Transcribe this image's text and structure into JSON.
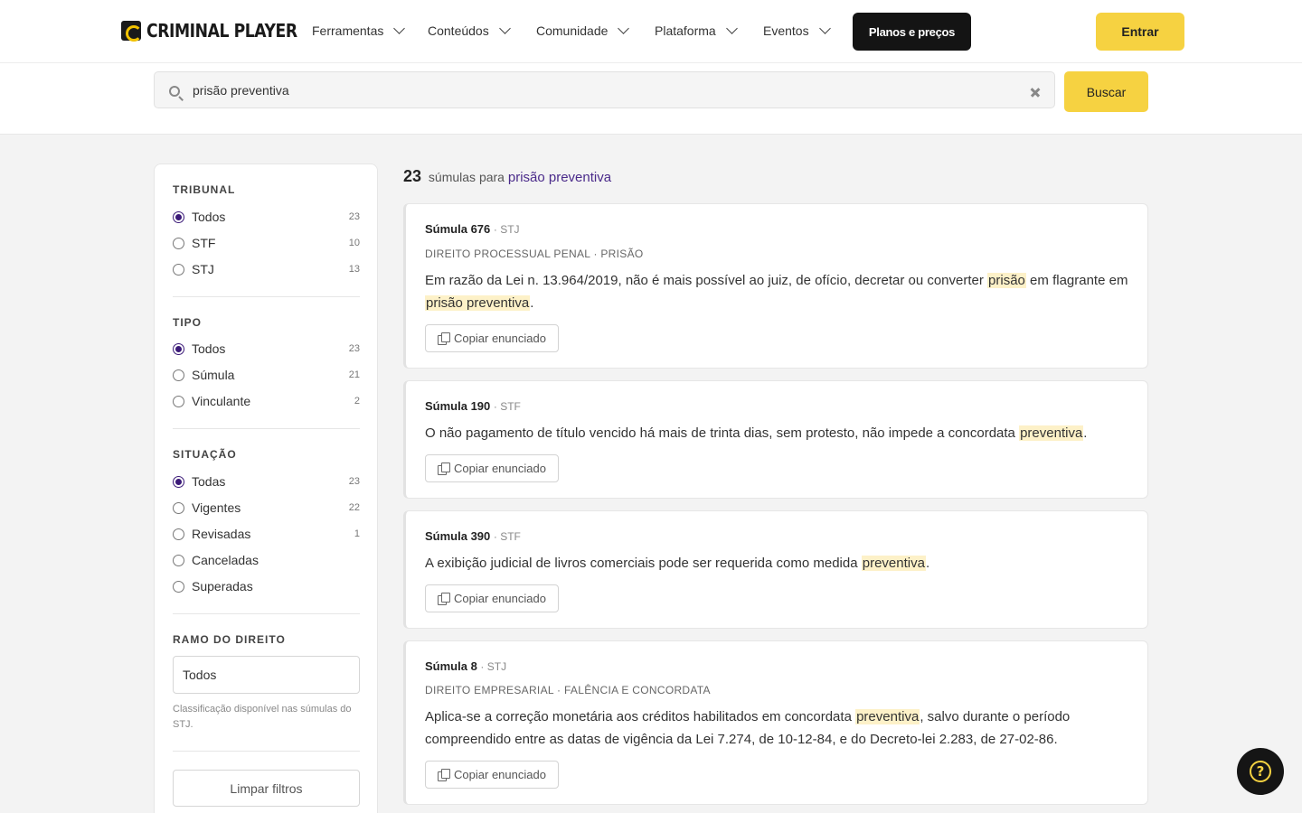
{
  "header": {
    "logo_text": "CRIMINAL PLAYER",
    "nav": [
      "Ferramentas",
      "Conteúdos",
      "Comunidade",
      "Plataforma",
      "Eventos"
    ],
    "planos_label": "Planos e preços",
    "entrar_label": "Entrar"
  },
  "search": {
    "value": "prisão preventiva",
    "button_label": "Buscar"
  },
  "filters": {
    "tribunal": {
      "title": "TRIBUNAL",
      "options": [
        {
          "label": "Todos",
          "count": "23"
        },
        {
          "label": "STF",
          "count": "10"
        },
        {
          "label": "STJ",
          "count": "13"
        }
      ]
    },
    "tipo": {
      "title": "TIPO",
      "options": [
        {
          "label": "Todos",
          "count": "23"
        },
        {
          "label": "Súmula",
          "count": "21"
        },
        {
          "label": "Vinculante",
          "count": "2"
        }
      ]
    },
    "situacao": {
      "title": "SITUAÇÃO",
      "options": [
        {
          "label": "Todas",
          "count": "23"
        },
        {
          "label": "Vigentes",
          "count": "22"
        },
        {
          "label": "Revisadas",
          "count": "1"
        },
        {
          "label": "Canceladas",
          "count": ""
        },
        {
          "label": "Superadas",
          "count": ""
        }
      ]
    },
    "ramo": {
      "title": "RAMO DO DIREITO",
      "selected": "Todos",
      "hint": "Classificação disponível nas súmulas do STJ."
    },
    "clear_label": "Limpar filtros"
  },
  "results": {
    "count": "23",
    "label": "súmulas para",
    "query": "prisão preventiva",
    "copy_label": "Copiar enunciado",
    "items": [
      {
        "title": "Súmula 676",
        "tribunal": "· STJ",
        "category": "DIREITO PROCESSUAL PENAL · PRISÃO",
        "t1": "Em razão da Lei n. 13.964/2019, não é mais possível ao juiz, de ofício, decretar ou converter ",
        "h1": "prisão",
        "t2": " em flagrante em ",
        "h2": "prisão preventiva",
        "t3": "."
      },
      {
        "title": "Súmula 190",
        "tribunal": "· STF",
        "t1": "O não pagamento de título vencido há mais de trinta dias, sem protesto, não impede a concordata ",
        "h1": "preventiva",
        "t2": "."
      },
      {
        "title": "Súmula 390",
        "tribunal": "· STF",
        "t1": "A exibição judicial de livros comerciais pode ser requerida como medida ",
        "h1": "preventiva",
        "t2": "."
      },
      {
        "title": "Súmula 8",
        "tribunal": "· STJ",
        "category": "DIREITO EMPRESARIAL · FALÊNCIA E CONCORDATA",
        "t1": "Aplica-se a correção monetária aos créditos habilitados em concordata ",
        "h1": "preventiva",
        "t2": ", salvo durante o período compreendido entre as datas de vigência da Lei 7.274, de 10-12-84, e do Decreto-lei 2.283, de 27-02-86."
      }
    ]
  },
  "help": {
    "icon": "question-icon",
    "glyph": "?"
  },
  "colors": {
    "accent_yellow": "#f6d241",
    "accent_purple": "#3b1a78",
    "highlight": "#fdf1c8",
    "dark": "#141414"
  }
}
